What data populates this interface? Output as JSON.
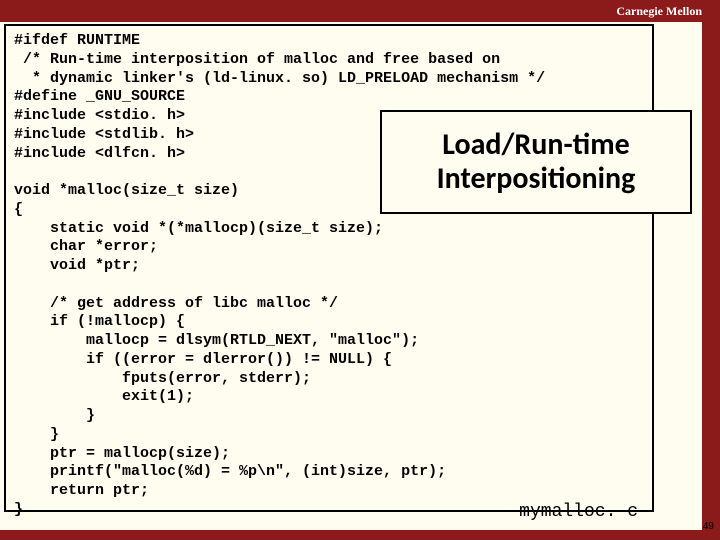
{
  "header": {
    "institution": "Carnegie Mellon"
  },
  "title": {
    "line1": "Load/Run-time",
    "line2": "Interpositioning"
  },
  "code": "#ifdef RUNTIME\n /* Run-time interposition of malloc and free based on\n  * dynamic linker's (ld-linux. so) LD_PRELOAD mechanism */\n#define _GNU_SOURCE\n#include <stdio. h>\n#include <stdlib. h>\n#include <dlfcn. h>\n\nvoid *malloc(size_t size)\n{\n    static void *(*mallocp)(size_t size);\n    char *error;\n    void *ptr;\n\n    /* get address of libc malloc */\n    if (!mallocp) {\n        mallocp = dlsym(RTLD_NEXT, \"malloc\");\n        if ((error = dlerror()) != NULL) {\n            fputs(error, stderr);\n            exit(1);\n        }\n    }\n    ptr = mallocp(size);\n    printf(\"malloc(%d) = %p\\n\", (int)size, ptr);\n    return ptr;\n}",
  "filename": "mymalloc. c",
  "page_number": "49"
}
